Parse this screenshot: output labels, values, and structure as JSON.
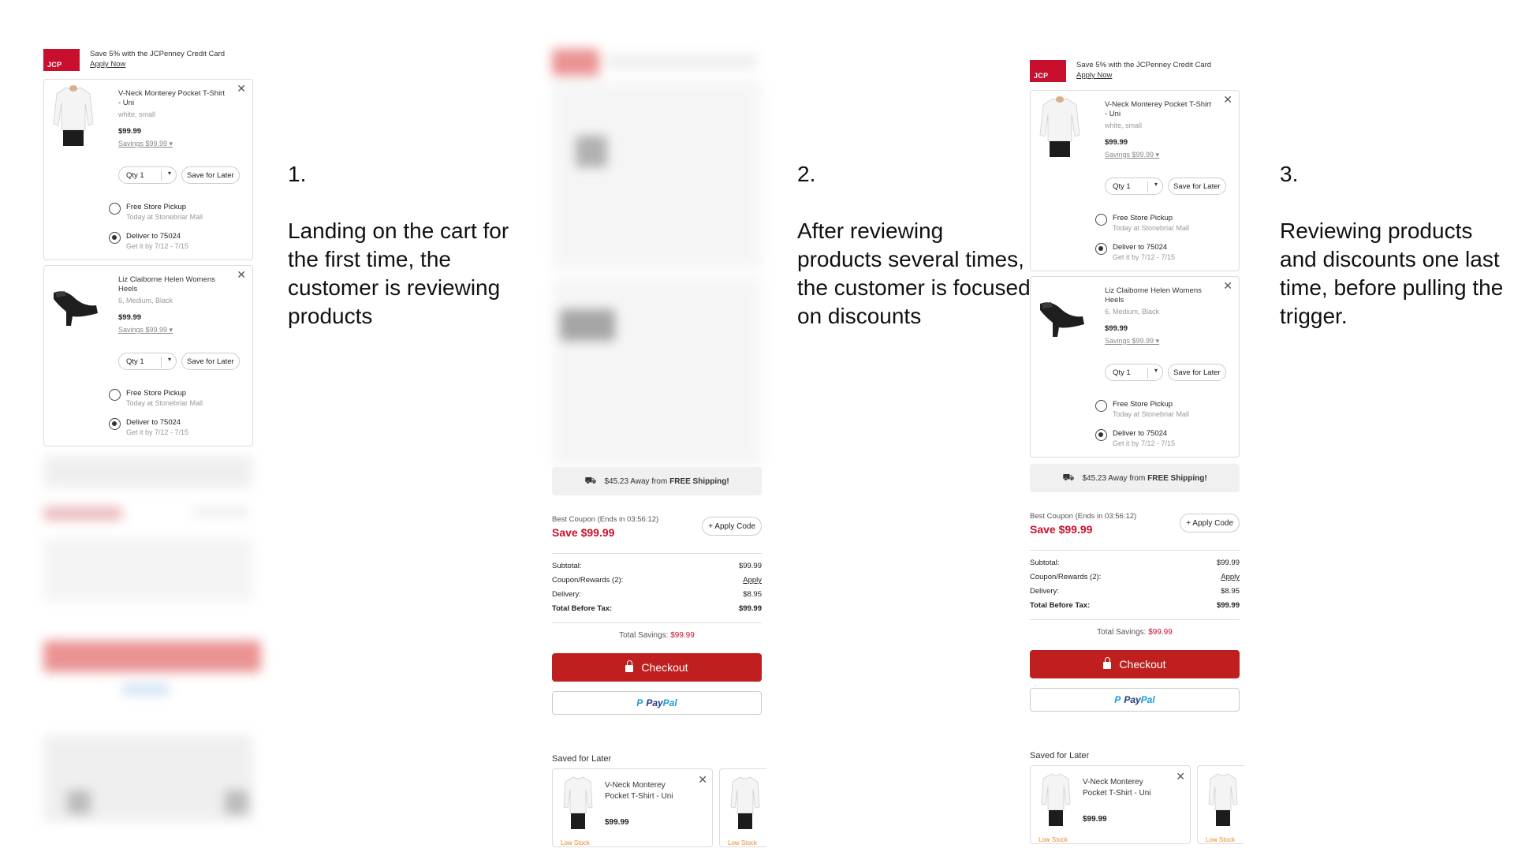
{
  "promo": {
    "logo_text": "JCP",
    "text": "Save 5% with the JCPenney Credit Card",
    "link": "Apply Now"
  },
  "items": [
    {
      "name": "V-Neck Monterey Pocket T-Shirt - Uni",
      "variant": "white, small",
      "price": "$99.99",
      "savings": "Savings $99.99 ▾",
      "qty": "Qty 1",
      "save_later": "Save for Later",
      "pickup": "Free Store Pickup",
      "pickup_sub": "Today at Stonebriar Mall",
      "deliver": "Deliver to 75024",
      "deliver_sub": "Get it by 7/12 - 7/15"
    },
    {
      "name": "Liz Claiborne Helen Womens Heels",
      "variant": "6, Medium, Black",
      "price": "$99.99",
      "savings": "Savings $99.99 ▾",
      "qty": "Qty 1",
      "save_later": "Save for Later",
      "pickup": "Free Store Pickup",
      "pickup_sub": "Today at Stonebriar Mall",
      "deliver": "Deliver to 75024",
      "deliver_sub": "Get it by 7/12 - 7/15"
    }
  ],
  "shipping": {
    "prefix": "$45.23 Away from ",
    "bold": "FREE Shipping!"
  },
  "coupon": {
    "label": "Best Coupon (Ends in 03:56:12)",
    "save": "Save $99.99",
    "apply": "+ Apply Code"
  },
  "summary": {
    "subtotal_label": "Subtotal:",
    "subtotal": "$99.99",
    "coupon_label": "Coupon/Rewards (2):",
    "coupon": "Apply",
    "delivery_label": "Delivery:",
    "delivery": "$8.95",
    "total_label": "Total Before Tax:",
    "total": "$99.99"
  },
  "total_savings": {
    "label": "Total Savings: ",
    "value": "$99.99"
  },
  "checkout": "Checkout",
  "paypal": {
    "icon": "P",
    "pay": "Pay",
    "pal": "Pal"
  },
  "saved": {
    "heading": "Saved for Later",
    "item_name": "V-Neck Monterey Pocket T-Shirt - Uni",
    "item_price": "$99.99",
    "low_stock": "Low Stock"
  },
  "captions": [
    {
      "num": "1.",
      "text": "Landing on the cart for the first time, the customer is reviewing products"
    },
    {
      "num": "2.",
      "text": "After reviewing products several times, the customer is focused on discounts"
    },
    {
      "num": "3.",
      "text": "Reviewing products and discounts one last time, before pulling the trigger."
    }
  ],
  "colors": {
    "brand_red": "#c8102e",
    "checkout_red": "#c01f1f",
    "low_stock": "#e98a2c",
    "paypal_blue": "#253b80"
  }
}
